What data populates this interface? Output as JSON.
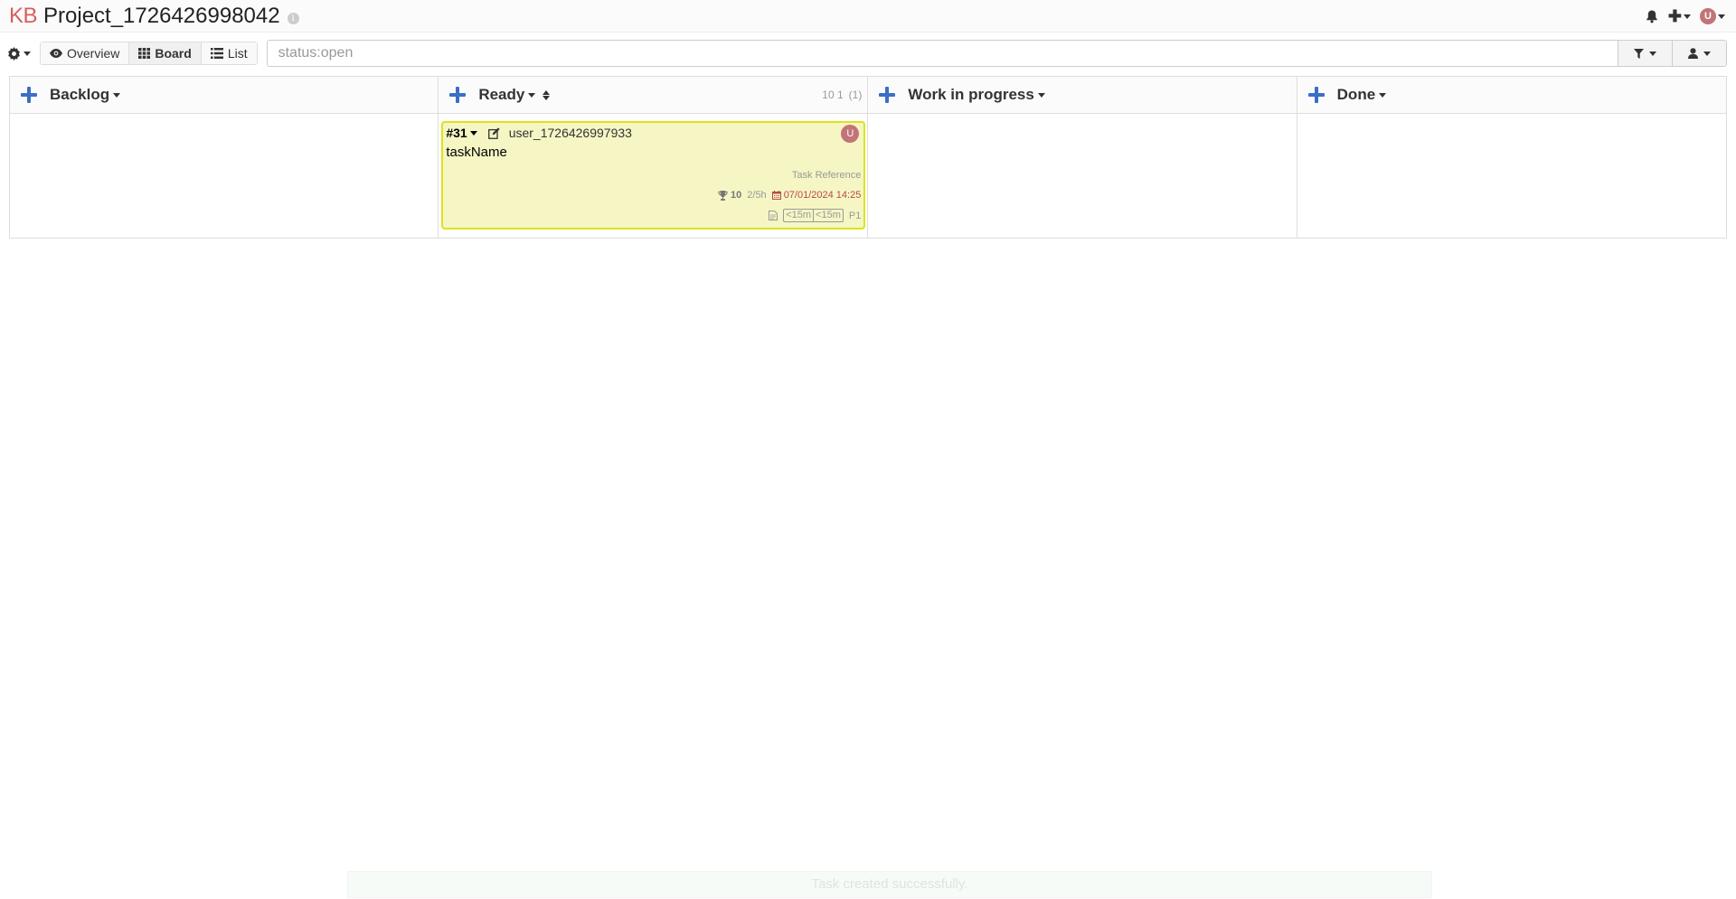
{
  "header": {
    "logo": "KB",
    "project_title": "Project_1726426998042",
    "info_glyph": "i",
    "avatar_initial": "U",
    "plus_glyph": "✚"
  },
  "toolbar": {
    "views": [
      {
        "label": "Overview",
        "icon": "eye-icon"
      },
      {
        "label": "Board",
        "icon": "grid-icon"
      },
      {
        "label": "List",
        "icon": "list-icon"
      }
    ],
    "search_value": "",
    "search_placeholder": "status:open"
  },
  "columns": [
    {
      "title": "Backlog"
    },
    {
      "title": "Ready",
      "count_a": "10 1",
      "count_b": "(1)"
    },
    {
      "title": "Work in progress"
    },
    {
      "title": "Done"
    }
  ],
  "task": {
    "id": "#31",
    "assignee": "user_1726426997933",
    "name": "taskName",
    "reference": "Task Reference",
    "score": "10",
    "time": "2/5h",
    "due": "07/01/2024 14:25",
    "time_spent": "<15m",
    "time_estimated": "<15m",
    "priority": "P1",
    "avatar_initial": "U",
    "colors": {
      "background": "#f5f6c4",
      "border": "#dfe21a",
      "due": "#b94a48"
    }
  },
  "flash": {
    "message": "Task created successfully."
  }
}
